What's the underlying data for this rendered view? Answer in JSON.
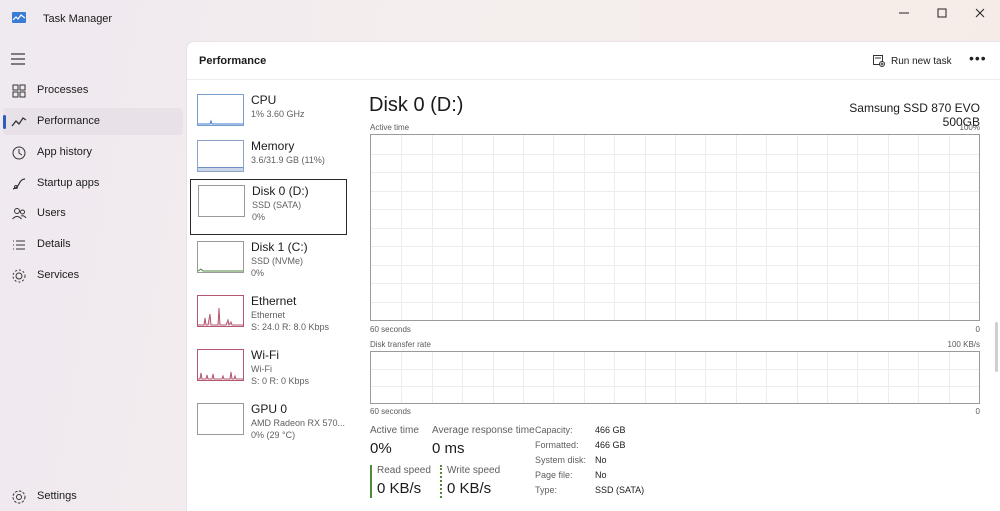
{
  "window": {
    "title": "Task Manager",
    "controls": {
      "minimize": "—",
      "maximize": "☐",
      "close": "✕"
    }
  },
  "nav": {
    "items": [
      {
        "label": "Processes",
        "icon": "processes-icon"
      },
      {
        "label": "Performance",
        "icon": "performance-icon",
        "active": true
      },
      {
        "label": "App history",
        "icon": "app-history-icon"
      },
      {
        "label": "Startup apps",
        "icon": "startup-apps-icon"
      },
      {
        "label": "Users",
        "icon": "users-icon"
      },
      {
        "label": "Details",
        "icon": "details-icon"
      },
      {
        "label": "Services",
        "icon": "services-icon"
      }
    ],
    "settings_label": "Settings"
  },
  "header": {
    "title": "Performance",
    "run_new_task": "Run new task",
    "more": "•••"
  },
  "devices": [
    {
      "name": "CPU",
      "sub1": "1%  3.60 GHz",
      "sub2": ""
    },
    {
      "name": "Memory",
      "sub1": "3.6/31.9 GB (11%)",
      "sub2": ""
    },
    {
      "name": "Disk 0 (D:)",
      "sub1": "SSD (SATA)",
      "sub2": "0%",
      "selected": true
    },
    {
      "name": "Disk 1 (C:)",
      "sub1": "SSD (NVMe)",
      "sub2": "0%"
    },
    {
      "name": "Ethernet",
      "sub1": "Ethernet",
      "sub2": "S: 24.0  R: 8.0 Kbps"
    },
    {
      "name": "Wi-Fi",
      "sub1": "Wi-Fi",
      "sub2": "S: 0  R: 0 Kbps"
    },
    {
      "name": "GPU 0",
      "sub1": "AMD Radeon RX 570...",
      "sub2": "0%  (29 °C)"
    }
  ],
  "detail": {
    "title": "Disk 0 (D:)",
    "model": "Samsung SSD 870 EVO 500GB",
    "active_time_graph": {
      "label": "Active time",
      "max": "100%",
      "x_left": "60 seconds",
      "x_right": "0"
    },
    "transfer_graph": {
      "label": "Disk transfer rate",
      "max": "100 KB/s",
      "x_left": "60 seconds",
      "x_right": "0"
    },
    "stats": {
      "active_time_label": "Active time",
      "active_time_value": "0%",
      "avg_response_label": "Average response time",
      "avg_response_value": "0 ms",
      "read_speed_label": "Read speed",
      "read_speed_value": "0 KB/s",
      "write_speed_label": "Write speed",
      "write_speed_value": "0 KB/s"
    },
    "properties": [
      {
        "label": "Capacity:",
        "value": "466 GB"
      },
      {
        "label": "Formatted:",
        "value": "466 GB"
      },
      {
        "label": "System disk:",
        "value": "No"
      },
      {
        "label": "Page file:",
        "value": "No"
      },
      {
        "label": "Type:",
        "value": "SSD (SATA)"
      }
    ]
  },
  "colors": {
    "accent": "#2b5fb8",
    "read": "#4f8a3c",
    "write": "#4f8a3c",
    "network": "#b3576e"
  }
}
